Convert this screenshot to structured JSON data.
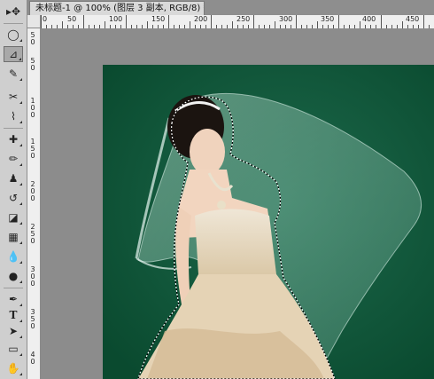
{
  "document_tab": {
    "title": "未标题-1 @ 100% (图层 3 副本, RGB/8) *",
    "close_glyph": "×"
  },
  "ruler_top": [
    "0",
    "50",
    "100",
    "150",
    "200",
    "250",
    "300",
    "350",
    "400",
    "450"
  ],
  "ruler_left": [
    "5",
    "0",
    "5",
    "0",
    "1",
    "0",
    "0",
    "1",
    "5",
    "0",
    "2",
    "0",
    "0",
    "2",
    "5",
    "0",
    "3",
    "0",
    "0",
    "3",
    "5",
    "0",
    "4",
    "0"
  ],
  "tools": [
    {
      "name": "move-tool",
      "icon": "move-icon",
      "glyph": "▸✥"
    },
    {
      "name": "marquee-tool",
      "icon": "elliptical-marquee-icon",
      "glyph": "◯"
    },
    {
      "name": "lasso-tool",
      "icon": "polygonal-lasso-icon",
      "glyph": "⊿"
    },
    {
      "name": "quick-selection-tool",
      "icon": "quick-selection-icon",
      "glyph": "✎"
    },
    {
      "name": "crop-tool",
      "icon": "crop-icon",
      "glyph": "✂"
    },
    {
      "name": "eyedropper-tool",
      "icon": "eyedropper-icon",
      "glyph": "⌇"
    },
    {
      "name": "healing-brush-tool",
      "icon": "healing-brush-icon",
      "glyph": "✚"
    },
    {
      "name": "brush-tool",
      "icon": "brush-icon",
      "glyph": "✏"
    },
    {
      "name": "clone-stamp-tool",
      "icon": "clone-stamp-icon",
      "glyph": "♟"
    },
    {
      "name": "history-brush-tool",
      "icon": "history-brush-icon",
      "glyph": "↺"
    },
    {
      "name": "eraser-tool",
      "icon": "eraser-icon",
      "glyph": "◪"
    },
    {
      "name": "gradient-tool",
      "icon": "gradient-icon",
      "glyph": "▦"
    },
    {
      "name": "blur-tool",
      "icon": "blur-icon",
      "glyph": "💧"
    },
    {
      "name": "dodge-tool",
      "icon": "dodge-icon",
      "glyph": "●"
    },
    {
      "name": "pen-tool",
      "icon": "pen-icon",
      "glyph": "✒"
    },
    {
      "name": "type-tool",
      "icon": "type-icon",
      "glyph": "T"
    },
    {
      "name": "path-selection-tool",
      "icon": "path-selection-icon",
      "glyph": "➤"
    },
    {
      "name": "shape-tool",
      "icon": "rectangle-shape-icon",
      "glyph": "▭"
    },
    {
      "name": "hand-tool",
      "icon": "hand-icon",
      "glyph": "✋"
    }
  ],
  "colors": {
    "canvas_background": "#0c5234",
    "workspace": "#8c8c8c",
    "toolbar": "#cfcfcf"
  }
}
